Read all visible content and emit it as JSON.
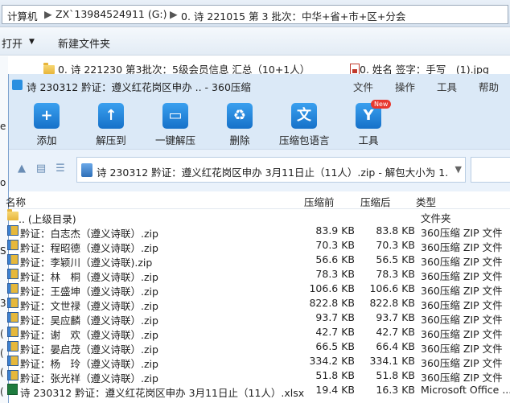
{
  "explorer": {
    "address_parts": [
      "计算机",
      "ZX`13984524911 (G:)",
      "0. 诗 221015 第 3 批次：中华+省+市+区+分会"
    ],
    "toolbar": {
      "open": "打开",
      "new_folder": "新建文件夹"
    },
    "files": [
      {
        "name": "0. 诗 221230 第3批次：5级会员信息 汇总（10+1人）",
        "icon": "folder-icon"
      },
      {
        "name": "0. 姓名 签字：手写　(1).jpg",
        "icon": "image-icon"
      }
    ]
  },
  "window": {
    "title": "诗 230312 黔证：遵义红花岗区申办 .. - 360压缩",
    "menu": [
      "文件",
      "操作",
      "工具",
      "帮助"
    ],
    "tools": [
      {
        "label": "添加",
        "icon": "add-icon"
      },
      {
        "label": "解压到",
        "icon": "extract-to-icon"
      },
      {
        "label": "一键解压",
        "icon": "one-click-extract-icon"
      },
      {
        "label": "删除",
        "icon": "delete-icon"
      },
      {
        "label": "压缩包语言",
        "icon": "archive-language-icon"
      },
      {
        "label": "工具",
        "icon": "tools-icon"
      }
    ],
    "new_badge": "New",
    "path": "诗 230312 黔证：遵义红花岗区申办 3月11日止（11人）.zip - 解包大小为 1.",
    "columns": {
      "name": "名称",
      "packed": "压缩前",
      "original": "压缩后",
      "type": "类型"
    },
    "parent_row": {
      "name": ".. (上级目录)",
      "type": "文件夹"
    },
    "rows": [
      {
        "name": "黔证：白志杰（遵义诗联）.zip",
        "packed": "83.9 KB",
        "original": "83.8 KB",
        "type": "360压缩 ZIP 文件"
      },
      {
        "name": "黔证：程昭德（遵义诗联）.zip",
        "packed": "70.3 KB",
        "original": "70.3 KB",
        "type": "360压缩 ZIP 文件"
      },
      {
        "name": "黔证：李颖川（遵义诗联).zip",
        "packed": "56.6 KB",
        "original": "56.5 KB",
        "type": "360压缩 ZIP 文件"
      },
      {
        "name": "黔证：林　桐（遵义诗联）.zip",
        "packed": "78.3 KB",
        "original": "78.3 KB",
        "type": "360压缩 ZIP 文件"
      },
      {
        "name": "黔证：王盛坤（遵义诗联）.zip",
        "packed": "106.6 KB",
        "original": "106.6 KB",
        "type": "360压缩 ZIP 文件"
      },
      {
        "name": "黔证：文世禄（遵义诗联）.zip",
        "packed": "822.8 KB",
        "original": "822.8 KB",
        "type": "360压缩 ZIP 文件"
      },
      {
        "name": "黔证：吴应麟（遵义诗联）.zip",
        "packed": "93.7 KB",
        "original": "93.7 KB",
        "type": "360压缩 ZIP 文件"
      },
      {
        "name": "黔证：谢　欢（遵义诗联）.zip",
        "packed": "42.7 KB",
        "original": "42.7 KB",
        "type": "360压缩 ZIP 文件"
      },
      {
        "name": "黔证：晏启茂（遵义诗联）.zip",
        "packed": "66.5 KB",
        "original": "66.4 KB",
        "type": "360压缩 ZIP 文件"
      },
      {
        "name": "黔证：杨　玲（遵义诗联）.zip",
        "packed": "334.2 KB",
        "original": "334.1 KB",
        "type": "360压缩 ZIP 文件"
      },
      {
        "name": "黔证：张光祥（遵义诗联）.zip",
        "packed": "51.8 KB",
        "original": "51.8 KB",
        "type": "360压缩 ZIP 文件"
      },
      {
        "name": "诗 230312 黔证：遵义红花岗区申办 3月11日止（11人）.xlsx",
        "packed": "19.4 KB",
        "original": "16.3 KB",
        "type": "Microsoft Office ..."
      }
    ]
  }
}
